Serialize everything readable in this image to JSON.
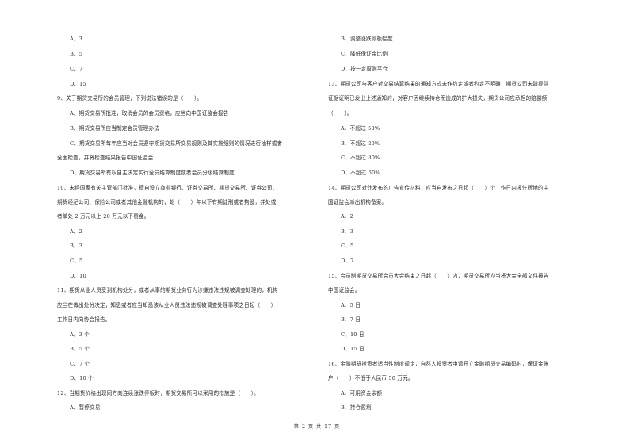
{
  "page": {
    "footer": "第 2 页 共 17 页"
  },
  "left_column": {
    "q8_options": [
      "A、3",
      "B、5",
      "C、7",
      "D、15"
    ],
    "q9": {
      "stem": "9、关于期货交易所的会员管理，下列说法错误的是（　　）。",
      "options": [
        "A、期货交易所批准，取消会员的会员资格，应当向中国证监会报告",
        "B、期货交易所应当制定会员管理办法",
        "C、期货交易所每年应当对会员遵守期货交易所交易规则及其实施细则的情况进行抽样或者",
        "全面检查，并将检查结果报告中国证监会",
        "D、期货交易所有权自主决定实行全员结算制度或者会员分级结算制度"
      ]
    },
    "q10": {
      "stem_lines": [
        "10、未经国家有关主管部门批准，擅自设立商业银行、证券交易所、期货交易所、证券公司、",
        "期货经纪公司、保险公司或者其他金融机构的，处（　　）年以下有期徒刑或者拘役，并处或",
        "者单处 2 万元以上 20 万元以下罚金。"
      ],
      "options": [
        "A、2",
        "B、3",
        "C、5",
        "D、10"
      ]
    },
    "q11": {
      "stem_lines": [
        "11、期货从业人员受到机构处分，或者从事的期货业务行为涉嫌违法违规被调查处理的，机构",
        "应当在做出处分决定，知悉或者应当知悉该从业人员违法违规被调查处理事项之日起（　　）",
        "工作日内向协会报告。"
      ],
      "options": [
        "A、3 个",
        "B、5 个",
        "C、7 个",
        "D、10 个"
      ]
    },
    "q12": {
      "stem": "12、当期货价格出现同方向连续涨跌停板时，期货交易所可以采用的措施是（　　）。",
      "options": [
        "A、暂停交易"
      ]
    }
  },
  "right_column": {
    "q12_options": [
      "B、调整涨跌停板幅度",
      "C、降低保证金比例",
      "D、按一定原则平仓"
    ],
    "q13": {
      "stem_lines": [
        "13、期货公司与客户对交易结算结果的通知方式未作约定或者约定不明确，期货公司未能提供",
        "证据证明已发出上述通知的，对客户因继续持仓而造成的扩大损失，期货公司应承担的赔偿额",
        "（　　）。"
      ],
      "options": [
        "A、不超过 50%",
        "B、不超过 20%",
        "C、不超过 80%",
        "D、不超过 60%"
      ]
    },
    "q14": {
      "stem_lines": [
        "14、期货公司对外发布的广告宣传材料，应当自发布之日起（　　）个工作日内报住所地的中",
        "国证监会派出机构备案。"
      ],
      "options": [
        "A、2",
        "B、3",
        "C、5",
        "D、7"
      ]
    },
    "q15": {
      "stem_lines": [
        "15、会员制期货交易所会员大会结束之日起（　　）内，期货交易所应当将大会全部文件报告",
        "中国证监会。"
      ],
      "options": [
        "A、5 日",
        "B、7 日",
        "C、10 日",
        "D、15 日"
      ]
    },
    "q16": {
      "stem_lines": [
        "16、金融期货投资者适当性制度规定，自然人投资者申请开立金融期货交易编码时，保证金账",
        "户（　　）不低于人民币 50 万元。"
      ],
      "options": [
        "A、可用资金余额",
        "B、持仓盈利"
      ]
    }
  }
}
